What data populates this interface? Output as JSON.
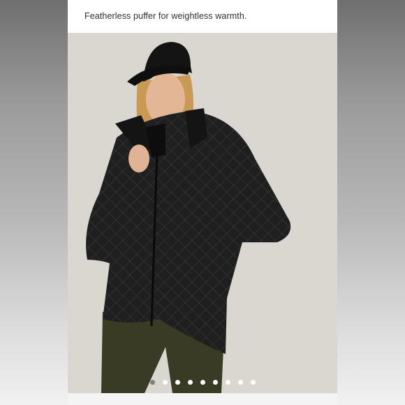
{
  "listing": {
    "description": "Featherless puffer for weightless warmth."
  },
  "carousel": {
    "total_slides": 9,
    "active_index": 0
  },
  "colors": {
    "photo_background": "#d9d7d0",
    "jacket": "#1e1e1e",
    "pants": "#3a3b24",
    "dot_active": "#7f7f7f",
    "dot_inactive": "#ffffff"
  }
}
